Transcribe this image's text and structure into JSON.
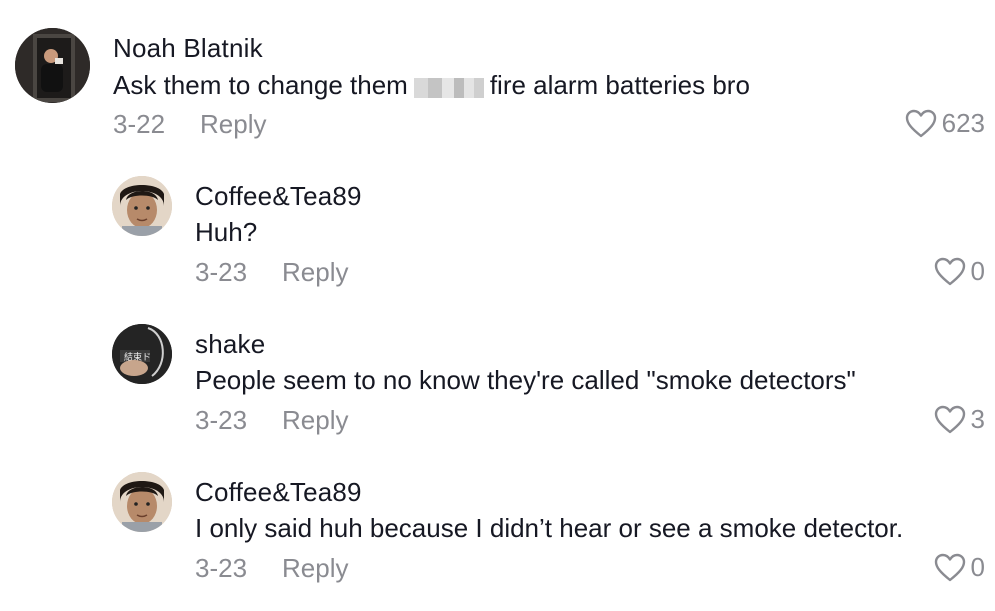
{
  "comments": [
    {
      "username": "Noah Blatnik",
      "text_before": "Ask them to change them",
      "censored": true,
      "text_after": "fire alarm batteries bro",
      "date": "3-22",
      "reply_label": "Reply",
      "likes": "623",
      "avatar_icon": "profile-photo"
    },
    {
      "username": "Coffee&Tea89",
      "text": "Huh?",
      "date": "3-23",
      "reply_label": "Reply",
      "likes": "0",
      "avatar_icon": "profile-photo"
    },
    {
      "username": "shake",
      "text": "People seem to no know they're called \"smoke detectors\"",
      "date": "3-23",
      "reply_label": "Reply",
      "likes": "3",
      "avatar_icon": "profile-photo"
    },
    {
      "username": "Coffee&Tea89",
      "text": "I only said huh because I didn’t hear or see a smoke detector.",
      "date": "3-23",
      "reply_label": "Reply",
      "likes": "0",
      "avatar_icon": "profile-photo"
    }
  ],
  "icons": {
    "like": "heart-outline-icon"
  }
}
